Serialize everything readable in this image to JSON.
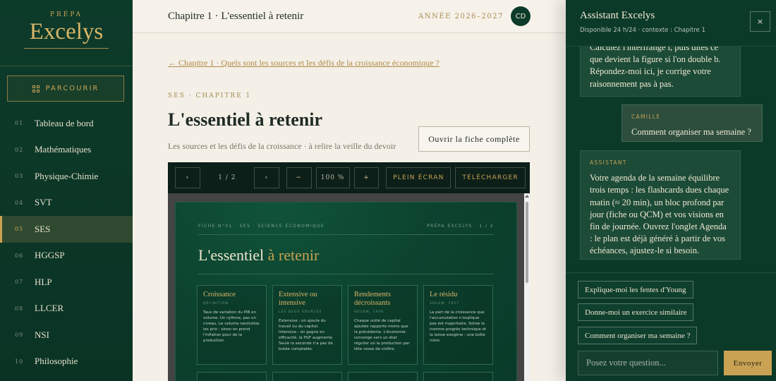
{
  "sidebar": {
    "brand_small": "PRÉPA",
    "brand_name": "Excelys",
    "browse_label": "PARCOURIR",
    "items": [
      {
        "num": "01",
        "label": "Tableau de bord"
      },
      {
        "num": "02",
        "label": "Mathématiques"
      },
      {
        "num": "03",
        "label": "Physique-Chimie"
      },
      {
        "num": "04",
        "label": "SVT"
      },
      {
        "num": "05",
        "label": "SES",
        "active": true
      },
      {
        "num": "06",
        "label": "HGGSP"
      },
      {
        "num": "07",
        "label": "HLP"
      },
      {
        "num": "08",
        "label": "LLCER"
      },
      {
        "num": "09",
        "label": "NSI"
      },
      {
        "num": "10",
        "label": "Philosophie"
      }
    ]
  },
  "header": {
    "title": "Chapitre 1 · L'essentiel à retenir",
    "year": "ANNÉE 2026–2027",
    "avatar": "CD"
  },
  "main": {
    "back_link": "← Chapitre 1 · Quels sont les sources et les défis de la croissance économique ?",
    "kicker": "SES · CHAPITRE 1",
    "title": "L'essentiel à retenir",
    "subtitle": "Les sources et les défis de la croissance · à relire la veille du devoir",
    "open_button": "Ouvrir la fiche complète"
  },
  "viewer": {
    "prev": "‹",
    "page": "1 / 2",
    "next": "›",
    "zoom_out": "−",
    "zoom": "100 %",
    "zoom_in": "+",
    "fullscreen": "PLEIN ÉCRAN",
    "download": "TÉLÉCHARGER"
  },
  "doc": {
    "head_left": "FICHE N°01 · SES · SCIENCE ÉCONOMIQUE",
    "head_right": "PRÉPA EXCELYS · 1 / 2",
    "title_main": "L'essentiel ",
    "title_accent": "à retenir",
    "cards": [
      {
        "title": "Croissance",
        "sub": "DÉFINITION",
        "body": "Taux de variation du PIB en volume. Un rythme, pas un niveau. Le volume neutralise les prix : sinon on prend l'inflation pour de la production."
      },
      {
        "title": "Extensive ou intensive",
        "sub": "LES DEUX SOURCES",
        "body": "Extensive : on ajoute du travail ou du capital. Intensive : on gagne en efficacité, la PGF augmente. Seule la seconde n'a pas de butée comptable."
      },
      {
        "title": "Rendements décroissants",
        "sub": "SOLOW, 1956",
        "body": "Chaque unité de capital ajoutée rapporte moins que la précédente. L'économie converge vers un état régulier où la production par tête cesse de croître."
      },
      {
        "title": "Le résidu",
        "sub": "SOLOW, 1957",
        "body": "La part de la croissance que l'accumulation n'explique pas est majoritaire. Solow la nomme progrès technique et la laisse exogène : une boîte noire."
      }
    ]
  },
  "assistant": {
    "title": "Assistant Excelys",
    "subtitle": "Disponible 24 h/24 · contexte : Chapitre 1",
    "close": "×",
    "msg1": "Calculez l'interfrange i, puis dites ce que devient la figure si l'on double b. Répondez-moi ici, je corrige votre raisonnement pas à pas.",
    "msg2_who": "CAMILLE",
    "msg2": "Comment organiser ma semaine ?",
    "msg3_who": "ASSISTANT",
    "msg3": "Votre agenda de la semaine équilibre trois temps : les flashcards dues chaque matin (≈ 20 min), un bloc profond par jour (fiche ou QCM) et vos visions en fin de journée. Ouvrez l'onglet Agenda : le plan est déjà généré à partir de vos échéances, ajustez-le si besoin.",
    "suggestions": [
      "Explique-moi les fentes d'Young",
      "Donne-moi un exercice similaire",
      "Comment organiser ma semaine ?"
    ],
    "input_placeholder": "Posez votre question...",
    "send": "Envoyer"
  }
}
